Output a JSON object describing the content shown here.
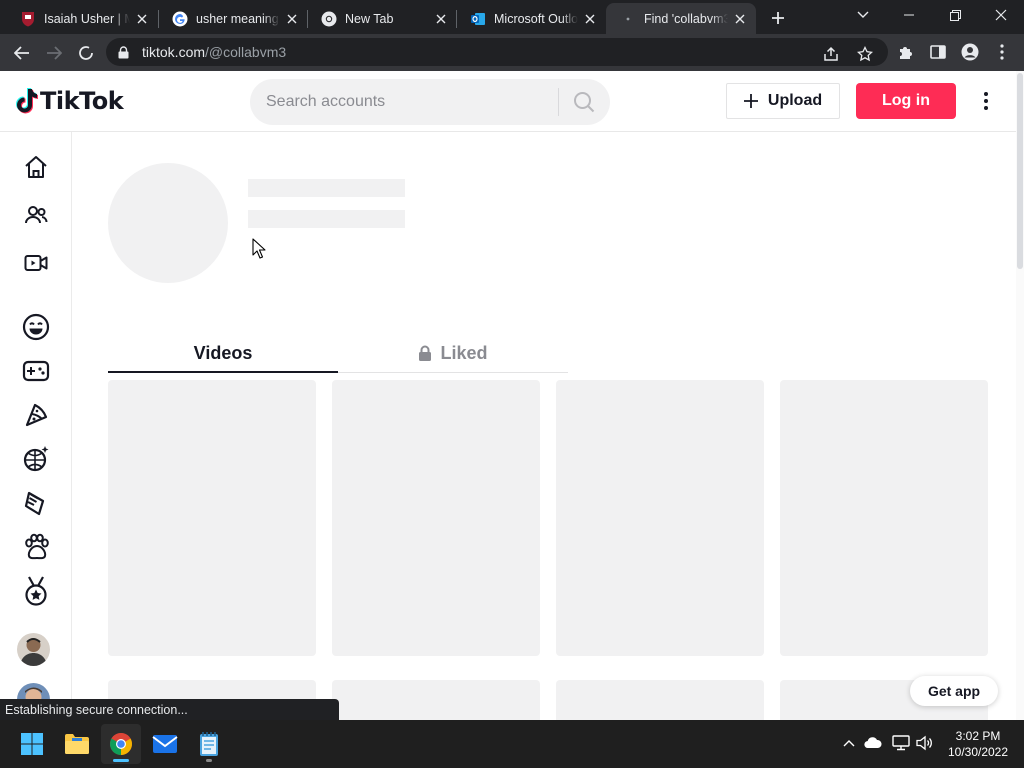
{
  "browser": {
    "tabs": [
      {
        "title": "Isaiah Usher | M",
        "favicon": "harvard-shield-icon",
        "active": false
      },
      {
        "title": "usher meaning",
        "favicon": "google-g-icon",
        "active": false
      },
      {
        "title": "New Tab",
        "favicon": "chrome-icon",
        "active": false
      },
      {
        "title": "Microsoft Outlo",
        "favicon": "outlook-icon",
        "active": false
      },
      {
        "title": "Find 'collabvm3",
        "favicon": "loading-dot-icon",
        "active": true
      }
    ],
    "address_bar": {
      "domain": "tiktok.com",
      "path": "/@collabvm3"
    },
    "status_text": "Establishing secure connection..."
  },
  "tiktok": {
    "logo_text": "TikTok",
    "search_placeholder": "Search accounts",
    "upload_label": "Upload",
    "login_label": "Log in",
    "profile_tabs": [
      {
        "label": "Videos",
        "active": true
      },
      {
        "label": "Liked",
        "active": false,
        "locked": true
      }
    ],
    "get_app_label": "Get app",
    "sidebar_icons": [
      "home-icon",
      "following-icon",
      "live-icon",
      "comedy-icon",
      "gaming-icon",
      "food-icon",
      "dance-icon",
      "beauty-icon",
      "animals-icon",
      "sports-icon"
    ],
    "colors": {
      "brand": "#fe2c55",
      "text": "#161823",
      "skeleton": "#f1f1f2"
    }
  },
  "taskbar": {
    "apps": [
      "windows-start-icon",
      "file-explorer-icon",
      "chrome-icon",
      "mail-icon",
      "notepad-icon"
    ],
    "tray": [
      "chevron-up-icon",
      "onedrive-icon",
      "network-icon",
      "volume-icon"
    ],
    "time": "3:02 PM",
    "date": "10/30/2022"
  }
}
